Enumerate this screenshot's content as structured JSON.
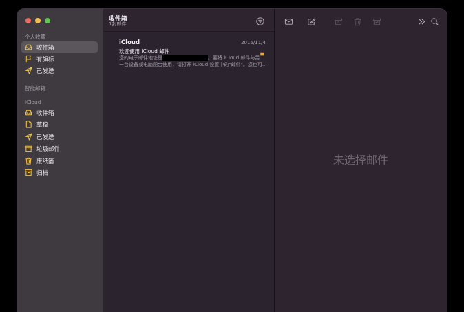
{
  "sidebar": {
    "favorites_title": "个人收藏",
    "favorites": [
      {
        "label": "收件箱",
        "icon": "inbox-icon",
        "selected": true
      },
      {
        "label": "有旗标",
        "icon": "flag-icon"
      },
      {
        "label": "已发送",
        "icon": "paperplane-icon"
      }
    ],
    "smart_title": "智能邮箱",
    "icloud_title": "iCloud",
    "icloud": [
      {
        "label": "收件箱",
        "icon": "inbox-icon"
      },
      {
        "label": "草稿",
        "icon": "draft-icon"
      },
      {
        "label": "已发送",
        "icon": "paperplane-icon"
      },
      {
        "label": "垃圾邮件",
        "icon": "junk-icon"
      },
      {
        "label": "废纸篓",
        "icon": "trash-icon"
      },
      {
        "label": "归档",
        "icon": "archive-icon"
      }
    ]
  },
  "list": {
    "title": "收件箱",
    "subtitle": "1封邮件",
    "messages": [
      {
        "sender": "iCloud",
        "date": "2015/11/4",
        "subject": "欢迎使用 iCloud 邮件",
        "preview_a": "您的电子邮件地址是",
        "preview_b": "。要将 iCloud 邮件与另",
        "preview_c": "一台设备或电脑配合使用，请打开 iCloud 设置中的\"邮件\"。您也可..."
      }
    ]
  },
  "content": {
    "empty_text": "未选择邮件"
  },
  "colors": {
    "accent": "#f5c542",
    "flag": "#f5a623"
  }
}
